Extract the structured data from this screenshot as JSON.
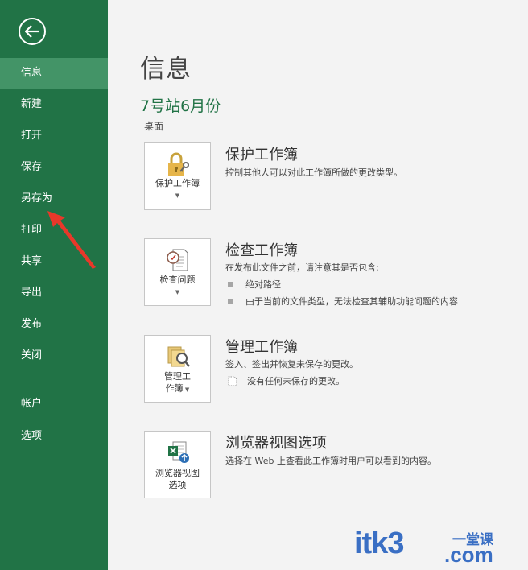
{
  "sidebar": {
    "items": [
      {
        "label": "信息",
        "active": true
      },
      {
        "label": "新建"
      },
      {
        "label": "打开"
      },
      {
        "label": "保存"
      },
      {
        "label": "另存为"
      },
      {
        "label": "打印"
      },
      {
        "label": "共享"
      },
      {
        "label": "导出"
      },
      {
        "label": "发布"
      },
      {
        "label": "关闭"
      },
      {
        "label": "帐户"
      },
      {
        "label": "选项"
      }
    ]
  },
  "main": {
    "title": "信息",
    "doc_name": "7号站6月份",
    "doc_location": "桌面",
    "sections": [
      {
        "tile_label": "保护工作簿",
        "title": "保护工作簿",
        "description": "控制其他人可以对此工作簿所做的更改类型。"
      },
      {
        "tile_label": "检查问题",
        "title": "检查工作簿",
        "description": "在发布此文件之前，请注意其是否包含:",
        "bullets": [
          "绝对路径",
          "由于当前的文件类型，无法检查其辅助功能问题的内容"
        ]
      },
      {
        "tile_label_line1": "管理工",
        "tile_label_line2": "作簿",
        "title": "管理工作簿",
        "description": "签入、签出并恢复未保存的更改。",
        "note": "没有任何未保存的更改。"
      },
      {
        "tile_label_line1": "浏览器视图",
        "tile_label_line2": "选项",
        "title": "浏览器视图选项",
        "description": "选择在 Web 上查看此工作簿时用户可以看到的内容。"
      }
    ]
  },
  "watermark": {
    "text": "itk3",
    "suffix": ".com",
    "cn": "一堂课"
  },
  "colors": {
    "sidebar": "#217346",
    "active": "#439467",
    "accent": "#217346",
    "arrow": "#e8382a"
  }
}
